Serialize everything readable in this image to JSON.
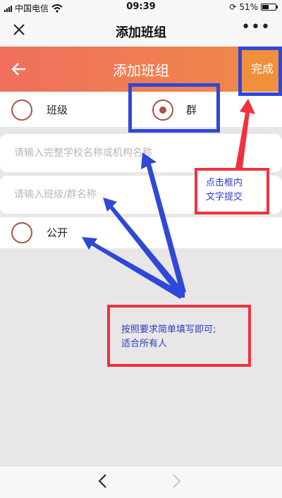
{
  "status_bar": {
    "carrier": "中国电信",
    "time": "09:39",
    "battery": "51%",
    "battery_level": 0.51
  },
  "nav": {
    "title": "添加班组",
    "close_icon": "close-icon",
    "more_icon": "more-icon"
  },
  "header": {
    "title": "添加班组",
    "done_label": "完成",
    "back_icon": "arrow-left-icon"
  },
  "type_options": [
    {
      "label": "班级",
      "checked": false
    },
    {
      "label": "群",
      "checked": true
    }
  ],
  "inputs": {
    "school_placeholder": "请输入完整学校名称或机构名称",
    "class_placeholder": "请输入班级/群名称"
  },
  "public_option": {
    "label": "公开",
    "checked": false
  },
  "annotations": {
    "submit_note_line1": "点击框内",
    "submit_note_line2": "文字提交",
    "fill_note_line1": "按照要求简单填写即可;",
    "fill_note_line2": "适合所有人"
  },
  "colors": {
    "header_start": "#ef6f5c",
    "header_end": "#f08a4a",
    "done_bg": "#f0903c",
    "radio": "#a55445",
    "annotation_blue": "#2e48d8",
    "annotation_red": "#ee3340"
  }
}
